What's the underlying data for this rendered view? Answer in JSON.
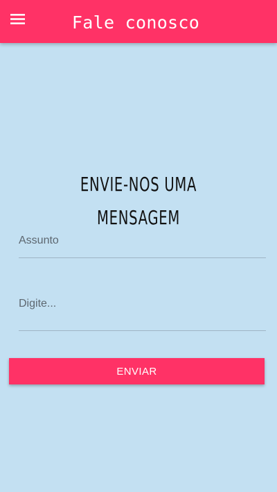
{
  "header": {
    "title": "Fale conosco",
    "menu_icon": "menu-icon"
  },
  "main": {
    "heading": "ENVIE-NOS UMA MENSAGEM",
    "subject": {
      "placeholder": "Assunto",
      "value": ""
    },
    "message": {
      "placeholder": "Digite...",
      "value": ""
    },
    "send_label": "ENVIAR"
  },
  "colors": {
    "primary": "#ff3266",
    "background": "#c3e0f2",
    "heading_text": "#111111",
    "placeholder_text": "#5d6770"
  }
}
